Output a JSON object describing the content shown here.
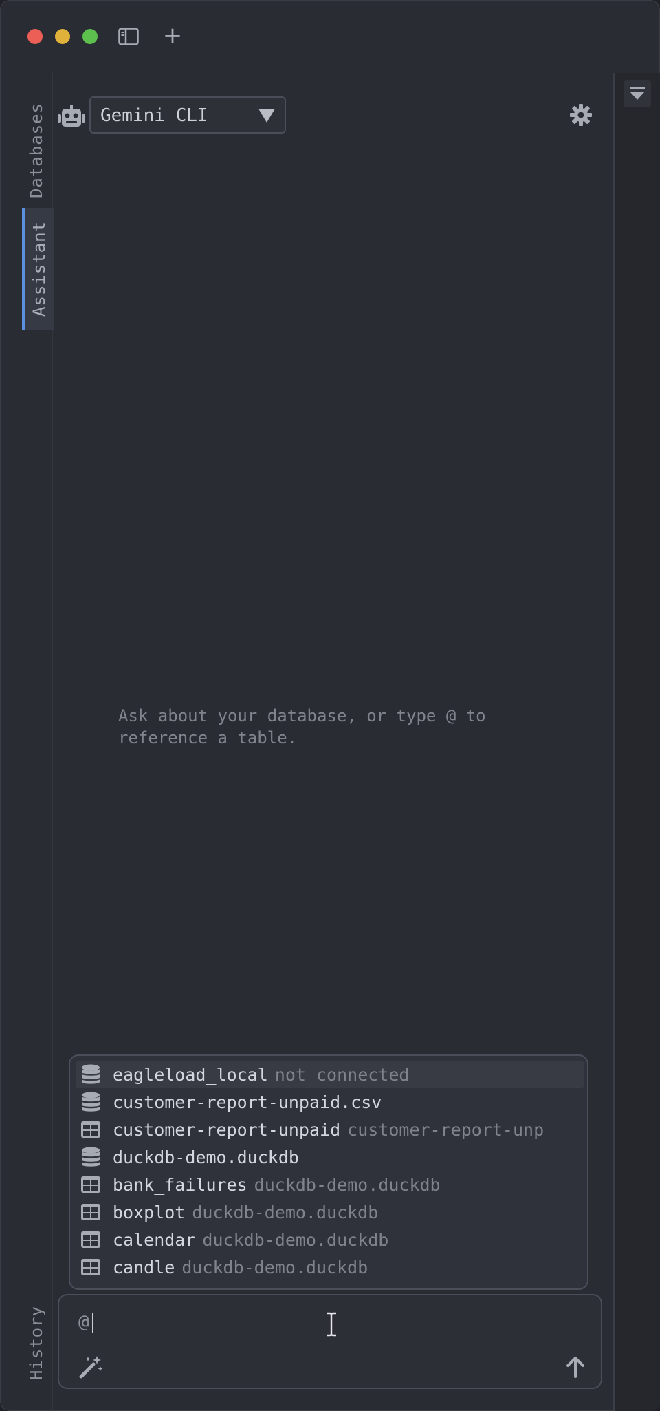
{
  "sidebar_tabs": {
    "databases": "Databases",
    "assistant": "Assistant",
    "history": "History"
  },
  "assistant": {
    "agent_selected": "Gemini CLI",
    "empty_hint": "Ask about your database, or type @ to\nreference a table."
  },
  "mention_menu": {
    "items": [
      {
        "type": "database",
        "name": "eagleload_local",
        "sub": "not connected"
      },
      {
        "type": "database",
        "name": "customer-report-unpaid.csv",
        "sub": ""
      },
      {
        "type": "table",
        "name": "customer-report-unpaid",
        "sub": "customer-report-unp"
      },
      {
        "type": "database",
        "name": "duckdb-demo.duckdb",
        "sub": ""
      },
      {
        "type": "table",
        "name": "bank_failures",
        "sub": "duckdb-demo.duckdb"
      },
      {
        "type": "table",
        "name": "boxplot",
        "sub": "duckdb-demo.duckdb"
      },
      {
        "type": "table",
        "name": "calendar",
        "sub": "duckdb-demo.duckdb"
      },
      {
        "type": "table",
        "name": "candle",
        "sub": "duckdb-demo.duckdb"
      }
    ]
  },
  "composer": {
    "value": "@"
  },
  "icons": {
    "database": "database-icon",
    "table": "table-icon"
  }
}
